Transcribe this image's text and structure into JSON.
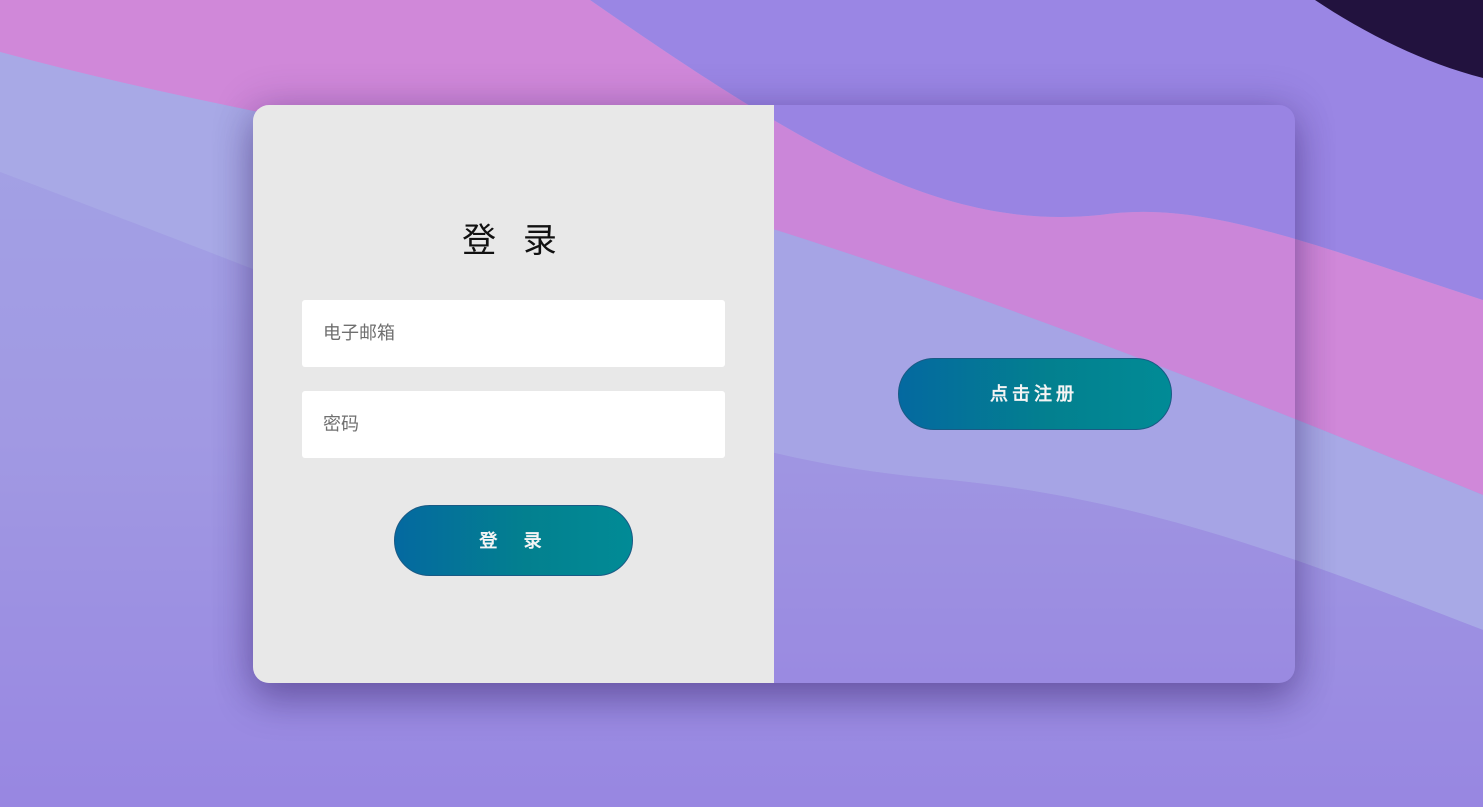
{
  "login": {
    "title": "登 录",
    "email_placeholder": "电子邮箱",
    "password_placeholder": "密码",
    "submit_label": "登 录"
  },
  "register": {
    "button_label": "点击注册"
  },
  "colors": {
    "button_gradient_start": "#0469a0",
    "button_gradient_end": "#018b96",
    "form_panel": "#e8e8e8",
    "background_pink": "#d285d8",
    "background_purple": "#9278e0"
  }
}
